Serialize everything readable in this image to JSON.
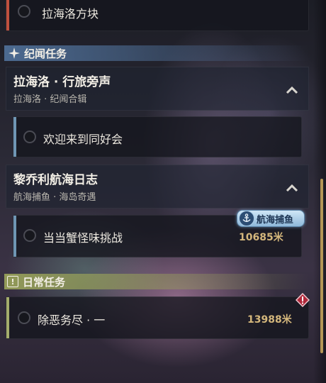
{
  "top_task": {
    "title": "拉海洛方块"
  },
  "sections": {
    "lore": {
      "label": "纪闻任务",
      "icon": "sparkle-icon"
    },
    "daily": {
      "label": "日常任务",
      "icon": "exclamation-icon"
    }
  },
  "quests": [
    {
      "title": "拉海洛 · 行旅旁声",
      "subtitle": "拉海洛 · 纪闻合辑",
      "task": {
        "title": "欢迎来到同好会"
      }
    },
    {
      "title": "黎乔利航海日志",
      "subtitle": "航海捕鱼 · 海岛奇遇",
      "task": {
        "title": "当当蟹怪味挑战",
        "distance": "10685米",
        "badge": "航海捕鱼"
      }
    }
  ],
  "daily_task": {
    "title": "除恶务尽 · 一",
    "distance": "13988米"
  },
  "colors": {
    "accent_red": "#c0503e",
    "accent_blue": "#6f96b4",
    "accent_green": "#a4ad6c",
    "lore_header": "#4e6e96",
    "daily_header": "#97a05a",
    "distance": "#d4b77c"
  }
}
